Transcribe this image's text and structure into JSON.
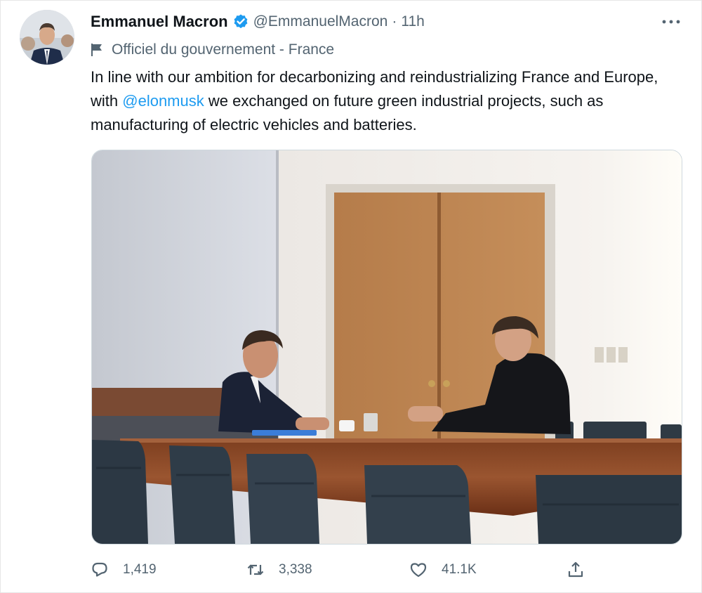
{
  "tweet": {
    "display_name": "Emmanuel Macron",
    "handle": "@EmmanuelMacron",
    "separator": "·",
    "time": "11h",
    "account_label": "Officiel du gouvernement - France",
    "text_part1": "In line with our ambition for decarbonizing and reindustrializing France and Europe, with ",
    "mention": "@elonmusk",
    "text_part2": " we exchanged on future green industrial projects, such as manufacturing of electric vehicles and batteries."
  },
  "actions": {
    "reply_count": "1,419",
    "retweet_count": "3,338",
    "like_count": "41.1K"
  },
  "colors": {
    "accent": "#1d9bf0",
    "secondary_text": "#536471",
    "primary_text": "#0f1419"
  },
  "icons": [
    "verified-badge-icon",
    "more-icon",
    "government-flag-icon",
    "reply-icon",
    "retweet-icon",
    "like-icon",
    "share-icon"
  ]
}
